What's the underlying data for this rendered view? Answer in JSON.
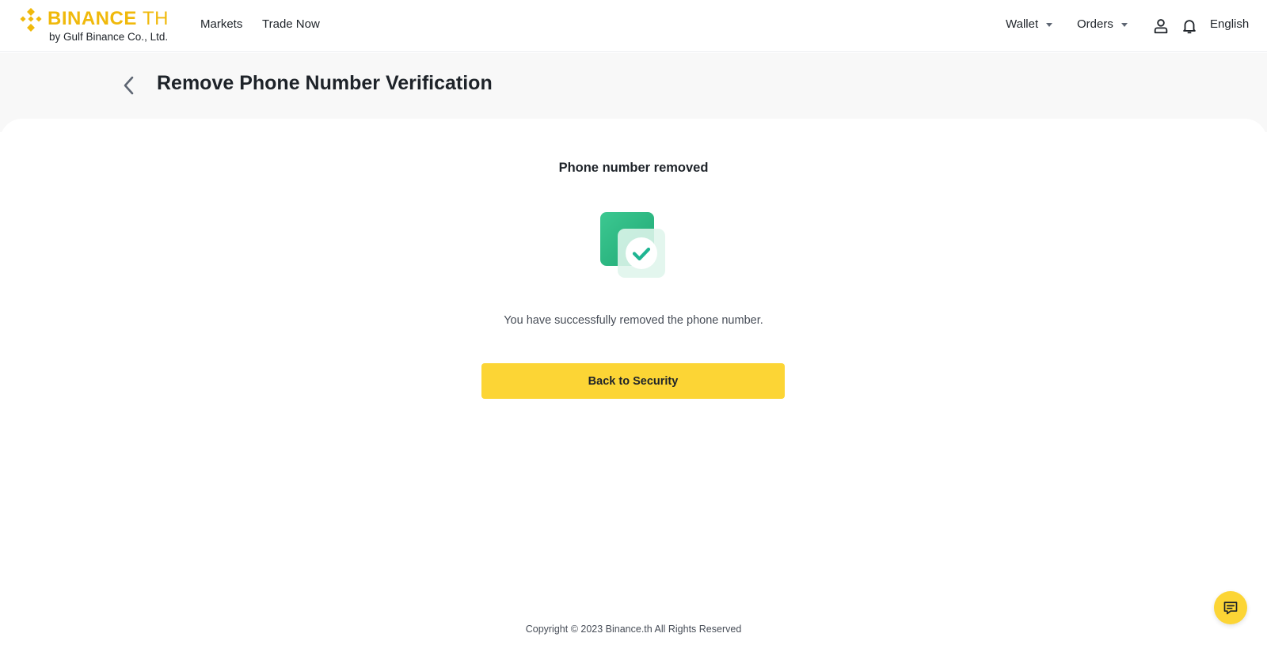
{
  "header": {
    "logo": {
      "brand": "BINANCE",
      "brand_suffix": "TH",
      "subtitle": "by Gulf Binance Co., Ltd."
    },
    "nav": {
      "markets": "Markets",
      "trade_now": "Trade Now"
    },
    "right": {
      "wallet": "Wallet",
      "orders": "Orders",
      "language": "English"
    },
    "icons": {
      "user": "user-icon",
      "bell": "bell-icon",
      "wallet_caret": "caret-down-icon",
      "orders_caret": "caret-down-icon"
    }
  },
  "page": {
    "title": "Remove Phone Number Verification",
    "back_icon": "chevron-left-icon"
  },
  "result": {
    "heading": "Phone number removed",
    "illustration": "success-check-icon",
    "message": "You have successfully removed the phone number.",
    "button_label": "Back to Security"
  },
  "footer": {
    "copyright": "Copyright © 2023 Binance.th All Rights Reserved"
  },
  "chat": {
    "icon": "chat-icon"
  },
  "colors": {
    "brand_yellow": "#F0B90B",
    "button_yellow": "#FCD535",
    "success_green": "#2EBD85",
    "text_primary": "#1E2329",
    "text_secondary": "#474D57"
  }
}
